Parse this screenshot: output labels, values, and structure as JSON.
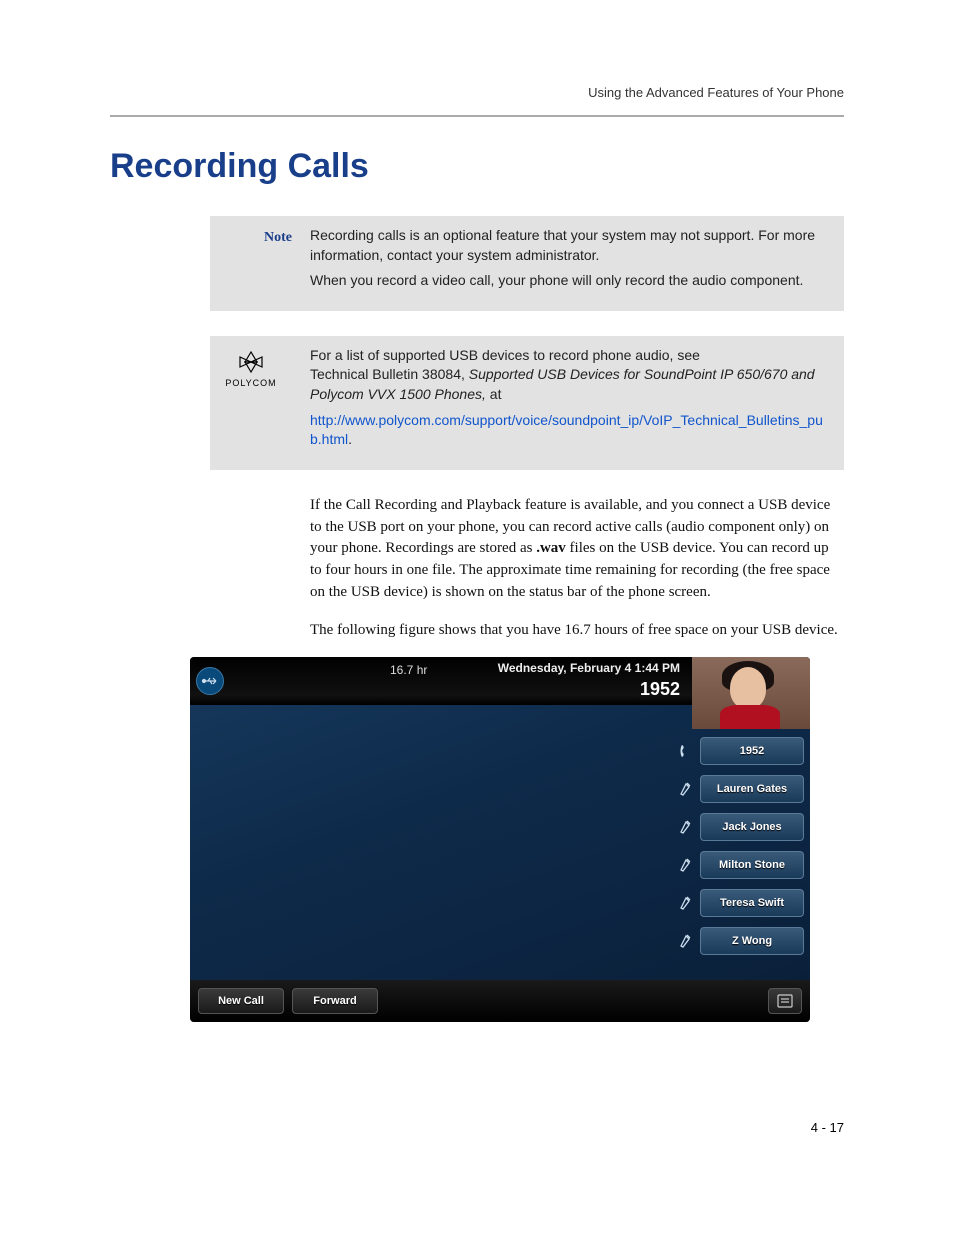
{
  "header": {
    "running_title": "Using the Advanced Features of Your Phone"
  },
  "section": {
    "title": "Recording Calls"
  },
  "note_box": {
    "label": "Note",
    "line1": "Recording calls is an optional feature that your system may not support. For more information, contact your system administrator.",
    "line2": "When you record a video call, your phone will only record the audio component."
  },
  "polycom_box": {
    "logo_word": "POLYCOM",
    "line1_a": "For a list of supported USB devices to record phone audio, see",
    "line1_b": "Technical Bulletin 38084, ",
    "line1_italic": "Supported USB Devices for SoundPoint IP 650/670 and Polycom VVX 1500 Phones,",
    "line1_c": " at",
    "link": "http://www.polycom.com/support/voice/soundpoint_ip/VoIP_Technical_Bulletins_pub.html",
    "period": "."
  },
  "body": {
    "para1_a": "If the Call Recording and Playback feature is available, and you connect a USB device to the USB port on your phone, you can record active calls (audio component only) on your phone. Recordings are stored as ",
    "para1_bold": ".wav",
    "para1_b": " files on the USB device. You can record up to four hours in one file. The approximate time remaining for recording (the free space on the USB device) is shown on the status bar of the phone screen.",
    "para2": "The following figure shows that you have 16.7 hours of free space on your USB device."
  },
  "phone": {
    "free_space": "16.7 hr",
    "datetime": "Wednesday, February 4  1:44 PM",
    "extension": "1952",
    "contacts": [
      {
        "label": "1952",
        "icon": "handset"
      },
      {
        "label": "Lauren Gates",
        "icon": "speeddial"
      },
      {
        "label": "Jack Jones",
        "icon": "speeddial"
      },
      {
        "label": "Milton Stone",
        "icon": "speeddial"
      },
      {
        "label": "Teresa Swift",
        "icon": "speeddial"
      },
      {
        "label": "Z Wong",
        "icon": "speeddial"
      }
    ],
    "softkeys": {
      "new_call": "New Call",
      "forward": "Forward"
    }
  },
  "footer": {
    "page_number": "4 - 17"
  }
}
